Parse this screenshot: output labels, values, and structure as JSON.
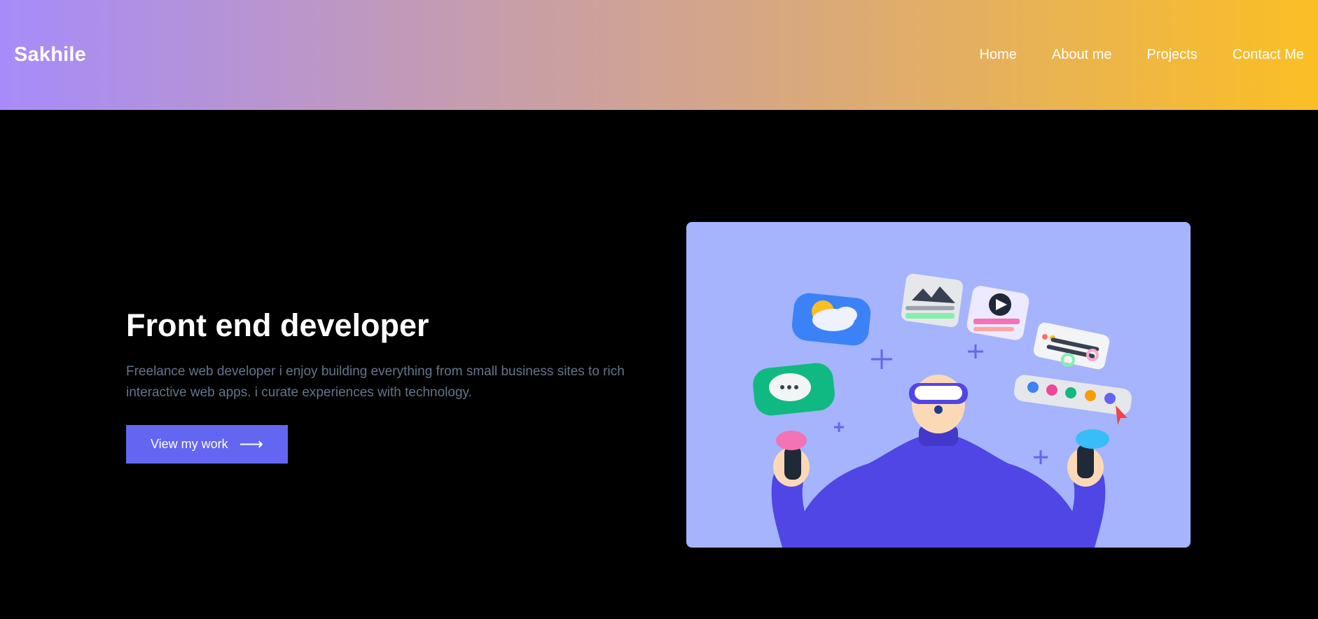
{
  "nav": {
    "brand": "Sakhile",
    "links": [
      {
        "label": "Home"
      },
      {
        "label": "About me"
      },
      {
        "label": "Projects"
      },
      {
        "label": "Contact Me"
      }
    ]
  },
  "hero": {
    "title": "Front end developer",
    "description": "Freelance web developer i enjoy building everything from small business sites to rich interactive web apps. i curate experiences with technology.",
    "cta_label": "View my work",
    "cta_icon": "arrow-right-icon"
  },
  "illustration": {
    "background_color": "#a5b4fc",
    "subject": "developer-with-vr-headset-icon"
  },
  "colors": {
    "accent": "#6366f1",
    "gradient_start": "#a78bfa",
    "gradient_end": "#fbbf24",
    "muted_text": "#64748b"
  }
}
